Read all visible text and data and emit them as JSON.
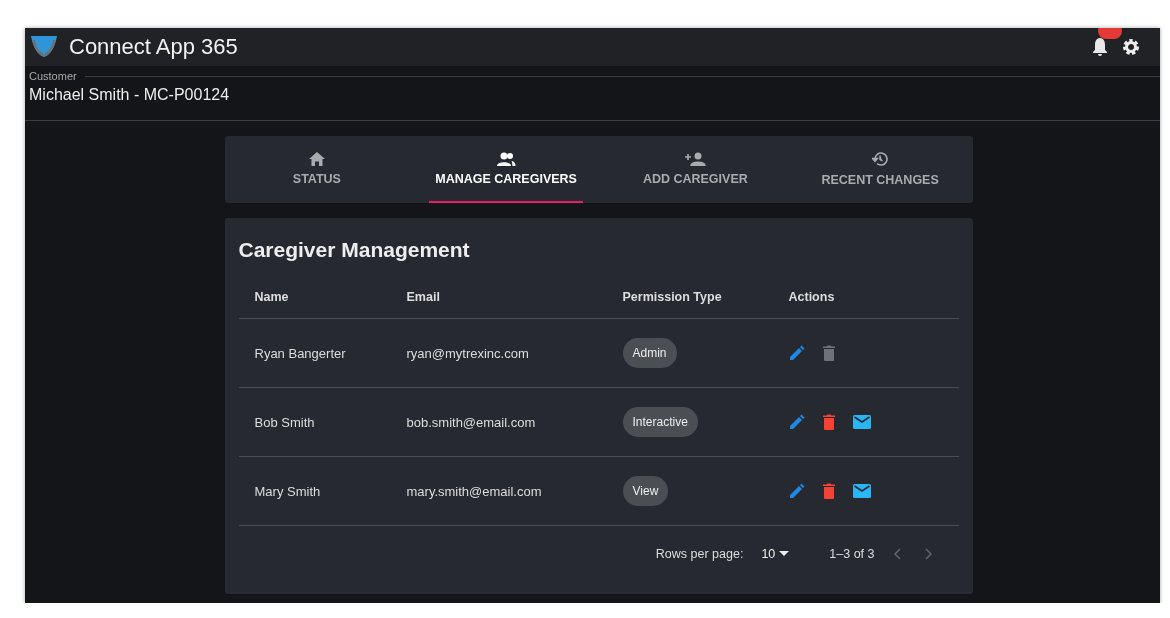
{
  "app": {
    "title": "Connect App 365"
  },
  "customer": {
    "label": "Customer",
    "value": "Michael Smith - MC-P00124"
  },
  "tabs": [
    {
      "label": "STATUS",
      "selected": false
    },
    {
      "label": "MANAGE CAREGIVERS",
      "selected": true
    },
    {
      "label": "ADD CAREGIVER",
      "selected": false
    },
    {
      "label": "RECENT CHANGES",
      "selected": false
    }
  ],
  "card": {
    "title": "Caregiver Management"
  },
  "table": {
    "columns": [
      "Name",
      "Email",
      "Permission Type",
      "Actions"
    ],
    "rows": [
      {
        "name": "Ryan Bangerter",
        "email": "ryan@mytrexinc.com",
        "permission": "Admin",
        "delete_disabled": true,
        "email_action": false
      },
      {
        "name": "Bob Smith",
        "email": "bob.smith@email.com",
        "permission": "Interactive",
        "delete_disabled": false,
        "email_action": true
      },
      {
        "name": "Mary Smith",
        "email": "mary.smith@email.com",
        "permission": "View",
        "delete_disabled": false,
        "email_action": true
      }
    ]
  },
  "pagination": {
    "rows_label": "Rows per page:",
    "rows_value": "10",
    "range": "1–3 of 3",
    "prev_disabled": true,
    "next_disabled": true
  }
}
